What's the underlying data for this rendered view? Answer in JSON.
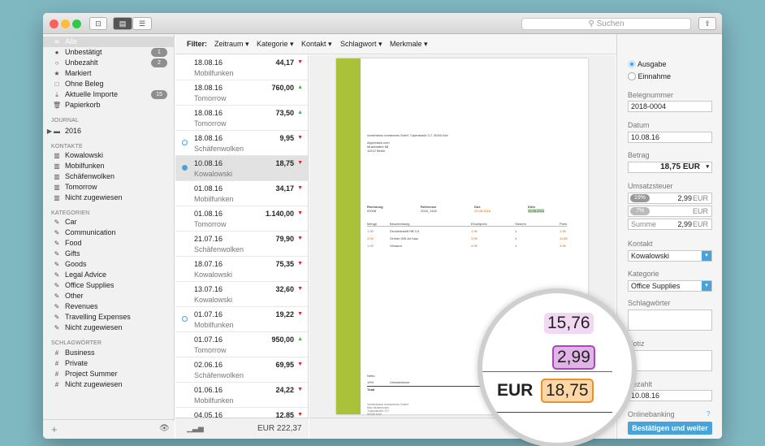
{
  "window": {
    "search_placeholder": "Suchen",
    "new_doc_icon": "inbox-icon",
    "view_icon": "sidebar-icon",
    "list_icon": "list-icon",
    "share_icon": "share-icon"
  },
  "sidebar": {
    "items": [
      {
        "label": "Alle",
        "icon": "stack-icon"
      },
      {
        "label": "Unbestätigt",
        "icon": "dot-icon",
        "badge": "1"
      },
      {
        "label": "Unbezahlt",
        "icon": "circle-icon",
        "badge": "2"
      },
      {
        "label": "Markiert",
        "icon": "star-icon"
      },
      {
        "label": "Ohne Beleg",
        "icon": "square-icon"
      },
      {
        "label": "Aktuelle Importe",
        "icon": "import-icon",
        "badge": "15"
      },
      {
        "label": "Papierkorb",
        "icon": "trash-icon"
      }
    ],
    "journal_header": "JOURNAL",
    "journal_items": [
      {
        "label": "2016"
      }
    ],
    "contacts_header": "KONTAKTE",
    "contacts": [
      "Kowalowski",
      "Mobilfunken",
      "Schäfenwolken",
      "Tomorrow",
      "Nicht zugewiesen"
    ],
    "categories_header": "KATEGORIEN",
    "categories": [
      "Car",
      "Communication",
      "Food",
      "Gifts",
      "Goods",
      "Legal Advice",
      "Office Supplies",
      "Other",
      "Revenues",
      "Travelling Expenses",
      "Nicht zugewiesen"
    ],
    "tags_header": "SCHLAGWÖRTER",
    "tags": [
      "Business",
      "Private",
      "Project Summer",
      "Nicht zugewiesen"
    ]
  },
  "filter": {
    "label": "Filter:",
    "options": [
      "Zeitraum ▾",
      "Kategorie ▾",
      "Kontakt ▾",
      "Schlagwort ▾",
      "Merkmale ▾"
    ]
  },
  "list": [
    {
      "date": "18.08.16",
      "contact": "Mobilfunken",
      "amount": "44,17",
      "dir": "down",
      "mark": ""
    },
    {
      "date": "18.08.16",
      "contact": "Tomorrow",
      "amount": "760,00",
      "dir": "up",
      "mark": ""
    },
    {
      "date": "18.08.16",
      "contact": "Tomorrow",
      "amount": "73,50",
      "dir": "up",
      "mark": ""
    },
    {
      "date": "18.08.16",
      "contact": "Schäfenwolken",
      "amount": "9,95",
      "dir": "down",
      "mark": "open"
    },
    {
      "date": "10.08.16",
      "contact": "Kowalowski",
      "amount": "18,75",
      "dir": "down",
      "mark": "filled",
      "selected": true
    },
    {
      "date": "01.08.16",
      "contact": "Mobilfunken",
      "amount": "34,17",
      "dir": "down",
      "mark": ""
    },
    {
      "date": "01.08.16",
      "contact": "Tomorrow",
      "amount": "1.140,00",
      "dir": "down",
      "mark": ""
    },
    {
      "date": "21.07.16",
      "contact": "Schäfenwolken",
      "amount": "79,90",
      "dir": "down",
      "mark": ""
    },
    {
      "date": "18.07.16",
      "contact": "Kowalowski",
      "amount": "75,35",
      "dir": "down",
      "mark": ""
    },
    {
      "date": "13.07.16",
      "contact": "Kowalowski",
      "amount": "32,60",
      "dir": "down",
      "mark": ""
    },
    {
      "date": "01.07.16",
      "contact": "Mobilfunken",
      "amount": "19,22",
      "dir": "down",
      "mark": "open"
    },
    {
      "date": "01.07.16",
      "contact": "Tomorrow",
      "amount": "950,00",
      "dir": "up",
      "mark": ""
    },
    {
      "date": "02.06.16",
      "contact": "Schäfenwolken",
      "amount": "69,95",
      "dir": "down",
      "mark": ""
    },
    {
      "date": "01.06.16",
      "contact": "Mobilfunken",
      "amount": "24,22",
      "dir": "down",
      "mark": ""
    },
    {
      "date": "04.05.16",
      "contact": "",
      "amount": "12,85",
      "dir": "down",
      "mark": ""
    }
  ],
  "list_footer": {
    "total": "EUR 222,37"
  },
  "document": {
    "sender": "Vorsteinbeck Investments GmbH, Tulpenstraße 217, 50345 Köln",
    "recipient": [
      "Appnetack.com",
      "Musterallee 88",
      "11012 Berlin"
    ],
    "meta_labels": [
      "Rechnung",
      "Reference",
      "Due",
      "Köln"
    ],
    "meta_values": [
      "00008",
      "2016_1402",
      "20.08.2016",
      "10.08.2016"
    ],
    "item_headers": [
      "Menge",
      "Beschreibung",
      "Einzelpreis",
      "Steuern",
      "Preis"
    ],
    "items": [
      [
        "1,00",
        "Druckbleistift HB 0,5",
        "1,95",
        "1",
        "1,95"
      ],
      [
        "3,00",
        "Ordner DIN A4 blau",
        "3,95",
        "1",
        "11,85"
      ],
      [
        "1,00",
        "Versand",
        "4,95",
        "1",
        "4,95"
      ]
    ],
    "totals_labels": [
      "Netto",
      "19%",
      "Umsatzsteuer",
      "Total"
    ],
    "footer": [
      "Vorsteinbeck Investments GmbH",
      "Max Mustermann",
      "Tulpenstraße 217",
      "50345 Köln"
    ]
  },
  "magnifier": {
    "net": "15,76",
    "tax": "2,99",
    "currency": "EUR",
    "total": "18,75"
  },
  "details": {
    "type_options": [
      "Ausgabe",
      "Einnahme"
    ],
    "belegnummer_label": "Belegnummer",
    "belegnummer": "2018-0004",
    "datum_label": "Datum",
    "datum": "10.08.16",
    "betrag_label": "Betrag",
    "betrag": "18,75 EUR",
    "ust_label": "Umsatzsteuer",
    "ust_rows": [
      {
        "rate": "19%",
        "value": "2,99",
        "unit": "EUR"
      },
      {
        "rate": "7%",
        "value": "",
        "unit": "EUR"
      }
    ],
    "summe_label": "Summe",
    "summe": "2,99",
    "summe_unit": "EUR",
    "kontakt_label": "Kontakt",
    "kontakt": "Kowalowski",
    "kategorie_label": "Kategorie",
    "kategorie": "Office Supplies",
    "schlagwoerter_label": "Schlagwörter",
    "notiz_label": "Notiz",
    "bezahlt_label": "Bezahlt",
    "bezahlt": "10.08.16",
    "onlinebanking_label": "Onlinebanking",
    "help": "?",
    "confirm_label": "Bestätigen und weiter"
  },
  "colors": {
    "accent": "#4aa3d8",
    "green_bar": "#a9c23a",
    "down": "#e0202c",
    "up": "#4cae4f"
  }
}
